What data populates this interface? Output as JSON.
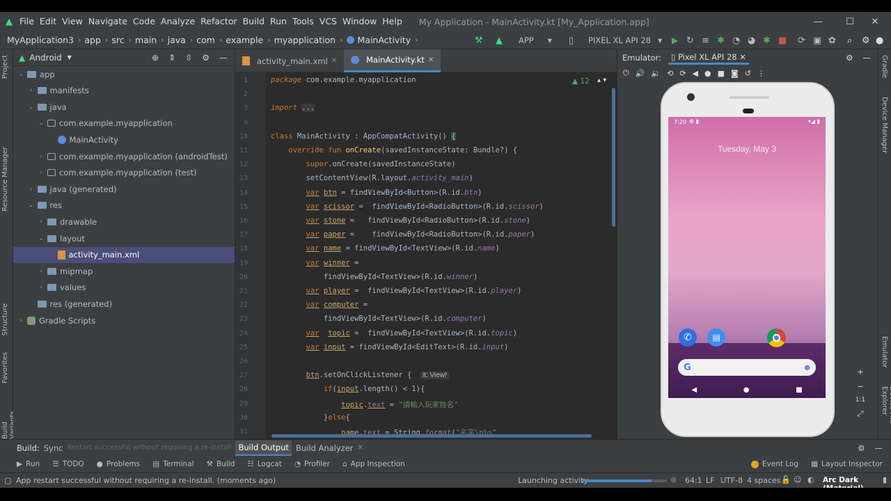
{
  "menubar": {
    "items": [
      "File",
      "Edit",
      "View",
      "Navigate",
      "Code",
      "Analyze",
      "Refactor",
      "Build",
      "Run",
      "Tools",
      "VCS",
      "Window",
      "Help"
    ],
    "window_title": "My Application - MainActivity.kt [My_Application.app]"
  },
  "window_controls": {
    "minimize": "—",
    "maximize": "☐",
    "close": "✕"
  },
  "breadcrumbs": [
    "MyApplication3",
    "app",
    "src",
    "main",
    "java",
    "com",
    "example",
    "myapplication",
    "MainActivity"
  ],
  "toolbar": {
    "config": "APP",
    "device": "PIXEL XL API 28"
  },
  "left_stripe": [
    "Project",
    "Resource Manager",
    "Structure",
    "Favorites",
    "Build Variants"
  ],
  "right_stripe": [
    "Gradle",
    "Device Manager",
    "Emulator",
    "Device File Explorer"
  ],
  "project": {
    "view": "Android",
    "tree": [
      {
        "label": "app",
        "depth": 0,
        "open": true,
        "icon": "folder"
      },
      {
        "label": "manifests",
        "depth": 1,
        "open": false,
        "icon": "folder"
      },
      {
        "label": "java",
        "depth": 1,
        "open": true,
        "icon": "folder"
      },
      {
        "label": "com.example.myapplication",
        "depth": 2,
        "open": true,
        "icon": "package"
      },
      {
        "label": "MainActivity",
        "depth": 3,
        "icon": "kotlin"
      },
      {
        "label": "com.example.myapplication (androidTest)",
        "depth": 2,
        "open": false,
        "icon": "package"
      },
      {
        "label": "com.example.myapplication (test)",
        "depth": 2,
        "open": false,
        "icon": "package"
      },
      {
        "label": "java (generated)",
        "depth": 1,
        "open": false,
        "icon": "folder"
      },
      {
        "label": "res",
        "depth": 1,
        "open": true,
        "icon": "folder"
      },
      {
        "label": "drawable",
        "depth": 2,
        "open": false,
        "icon": "folder"
      },
      {
        "label": "layout",
        "depth": 2,
        "open": true,
        "icon": "folder"
      },
      {
        "label": "activity_main.xml",
        "depth": 3,
        "icon": "xml",
        "selected": true
      },
      {
        "label": "mipmap",
        "depth": 2,
        "open": false,
        "icon": "folder"
      },
      {
        "label": "values",
        "depth": 2,
        "open": false,
        "icon": "folder"
      },
      {
        "label": "res (generated)",
        "depth": 1,
        "icon": "folder"
      },
      {
        "label": "Gradle Scripts",
        "depth": 0,
        "open": false,
        "icon": "gradle"
      }
    ]
  },
  "editor": {
    "tabs": [
      "activity_main.xml",
      "MainActivity.kt"
    ],
    "active_tab": 1,
    "warnings": "▲ 12",
    "lines": [
      {
        "n": "1",
        "html": "<span class='kw' style='font-style:italic'>package</span> com.example.myapplication"
      },
      {
        "n": "2",
        "html": ""
      },
      {
        "n": "3",
        "html": "<span class='kw' style='font-style:italic'>import</span> <span style='background:#3b3b3b'>...</span>"
      },
      {
        "n": "9",
        "html": ""
      },
      {
        "n": "10",
        "html": "<span class='kw'>class</span> MainActivity : AppCompatActivity() <span style='background:#3b514d'>{</span>"
      },
      {
        "n": "11",
        "html": "    <span class='kw'>override fun</span> <span class='fn'>onCreate</span>(savedInstanceState: Bundle?) {"
      },
      {
        "n": "12",
        "html": "        <span class='kw'>super</span>.onCreate(savedInstanceState)"
      },
      {
        "n": "13",
        "html": "        setContentView(R.layout.<span class='it'>activity_main</span>)"
      },
      {
        "n": "14",
        "html": "        <span class='kw un'>var</span> <span class='un' style='color:#c9a66b'>btn</span> = findViewById&lt;Button&gt;(R.id.<span class='it'>btn</span>)"
      },
      {
        "n": "15",
        "html": "        <span class='kw un'>var</span> <span class='un' style='color:#c9a66b'>scissor</span> =  findViewById&lt;RadioButton&gt;(R.id.<span class='it'>scissor</span>)"
      },
      {
        "n": "16",
        "html": "        <span class='kw un'>var</span> <span class='un' style='color:#c9a66b'>stone</span> =   findViewById&lt;RadioButton&gt;(R.id.<span class='it'>stone</span>)"
      },
      {
        "n": "17",
        "html": "        <span class='kw un'>var</span> <span class='un' style='color:#c9a66b'>paper</span> =    findViewById&lt;RadioButton&gt;(R.id.<span class='it'>paper</span>)"
      },
      {
        "n": "18",
        "html": "        <span class='kw un'>var</span> <span class='un' style='color:#c9a66b'>name</span> = findViewById&lt;TextView&gt;(R.id.<span class='it'>name</span>)"
      },
      {
        "n": "19",
        "html": "        <span class='kw un'>var</span> <span class='un' style='color:#c9a66b'>winner</span> ="
      },
      {
        "n": "20",
        "html": "            findViewById&lt;TextView&gt;(R.id.<span class='it'>winner</span>)"
      },
      {
        "n": "21",
        "html": "        <span class='kw un'>var</span> <span class='un' style='color:#c9a66b'>player</span> =  findViewById&lt;TextView&gt;(R.id.<span class='it'>player</span>)"
      },
      {
        "n": "22",
        "html": "        <span class='kw un'>var</span> <span class='un' style='color:#c9a66b'>computer</span> ="
      },
      {
        "n": "23",
        "html": "            findViewById&lt;TextView&gt;(R.id.<span class='it'>computer</span>)"
      },
      {
        "n": "24",
        "html": "        <span class='kw un'>var</span>  <span class='un' style='color:#c9a66b'>topic</span> =  findViewById&lt;TextView&gt;(R.id.<span class='it'>topic</span>)"
      },
      {
        "n": "25",
        "html": "        <span class='kw un'>var</span> <span class='un' style='color:#c9a66b'>input</span> = findViewById&lt;EditText&gt;(R.id.<span class='it'>input</span>)"
      },
      {
        "n": "26",
        "html": ""
      },
      {
        "n": "27",
        "html": "        <span class='un' style='color:#c9a66b'>btn</span>.setOnClickListener {  <span class='hint'>it: View!</span>"
      },
      {
        "n": "28",
        "html": "            <span class='kw'>if</span>(<span class='un' style='color:#c9a66b'>input</span>.length() &lt; 1){"
      },
      {
        "n": "29",
        "html": "                <span class='un' style='color:#c9a66b'>topic</span>.<span class='un' style='color:#9876aa'>text</span> = <span class='str'>\"請輸入玩家姓名\"</span>"
      },
      {
        "n": "30",
        "html": "            }<span class='kw'>else</span>{"
      },
      {
        "n": "31",
        "html": "                <span class='un' style='color:#c9a66b'>name</span>.<span class='un' style='color:#9876aa'>text</span> = String.<span class='it'>format</span>(<span class='str'>\"名字\\n%s\"</span>"
      }
    ]
  },
  "emulator": {
    "label": "Emulator:",
    "device_tab": "Pixel XL API 28",
    "zoom": [
      "+",
      "−",
      "1:1",
      "⤢"
    ]
  },
  "phone": {
    "time": "7:20",
    "date": "Tuesday, May 3"
  },
  "build_tabs": {
    "label": "Build:",
    "tabs": [
      "Sync",
      "Build Output",
      "Build Analyzer"
    ],
    "ghost": "Restart successful without requiring a re-install"
  },
  "tool_windows": [
    "Run",
    "TODO",
    "Problems",
    "Terminal",
    "Build",
    "Logcat",
    "Profiler",
    "App Inspection"
  ],
  "tool_windows_right": [
    "Event Log",
    "Layout Inspector"
  ],
  "status": {
    "message": "App restart successful without requiring a re-install. (moments ago)",
    "task": "Launching activity",
    "progress": 0.82,
    "position": "64:1",
    "line_sep": "LF",
    "encoding": "UTF-8",
    "indent": "4 spaces",
    "theme": "Arc Dark (Material)"
  }
}
